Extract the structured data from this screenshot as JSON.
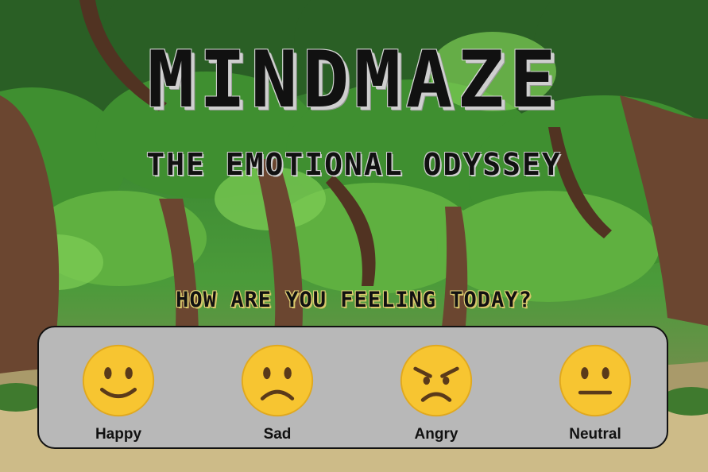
{
  "game": {
    "title": "MINDMAZE",
    "subtitle": "THE EMOTIONAL ODYSSEY",
    "question": "HOW ARE YOU FEELING TODAY?"
  },
  "moods": [
    {
      "label": "Happy",
      "icon": "happy-face-icon"
    },
    {
      "label": "Sad",
      "icon": "sad-face-icon"
    },
    {
      "label": "Angry",
      "icon": "angry-face-icon"
    },
    {
      "label": "Neutral",
      "icon": "neutral-face-icon"
    }
  ],
  "colors": {
    "panel_bg": "#b8b8b8",
    "emoji_yellow": "#f7c531",
    "foliage": "#3d8a33",
    "trunk": "#6b4630"
  }
}
